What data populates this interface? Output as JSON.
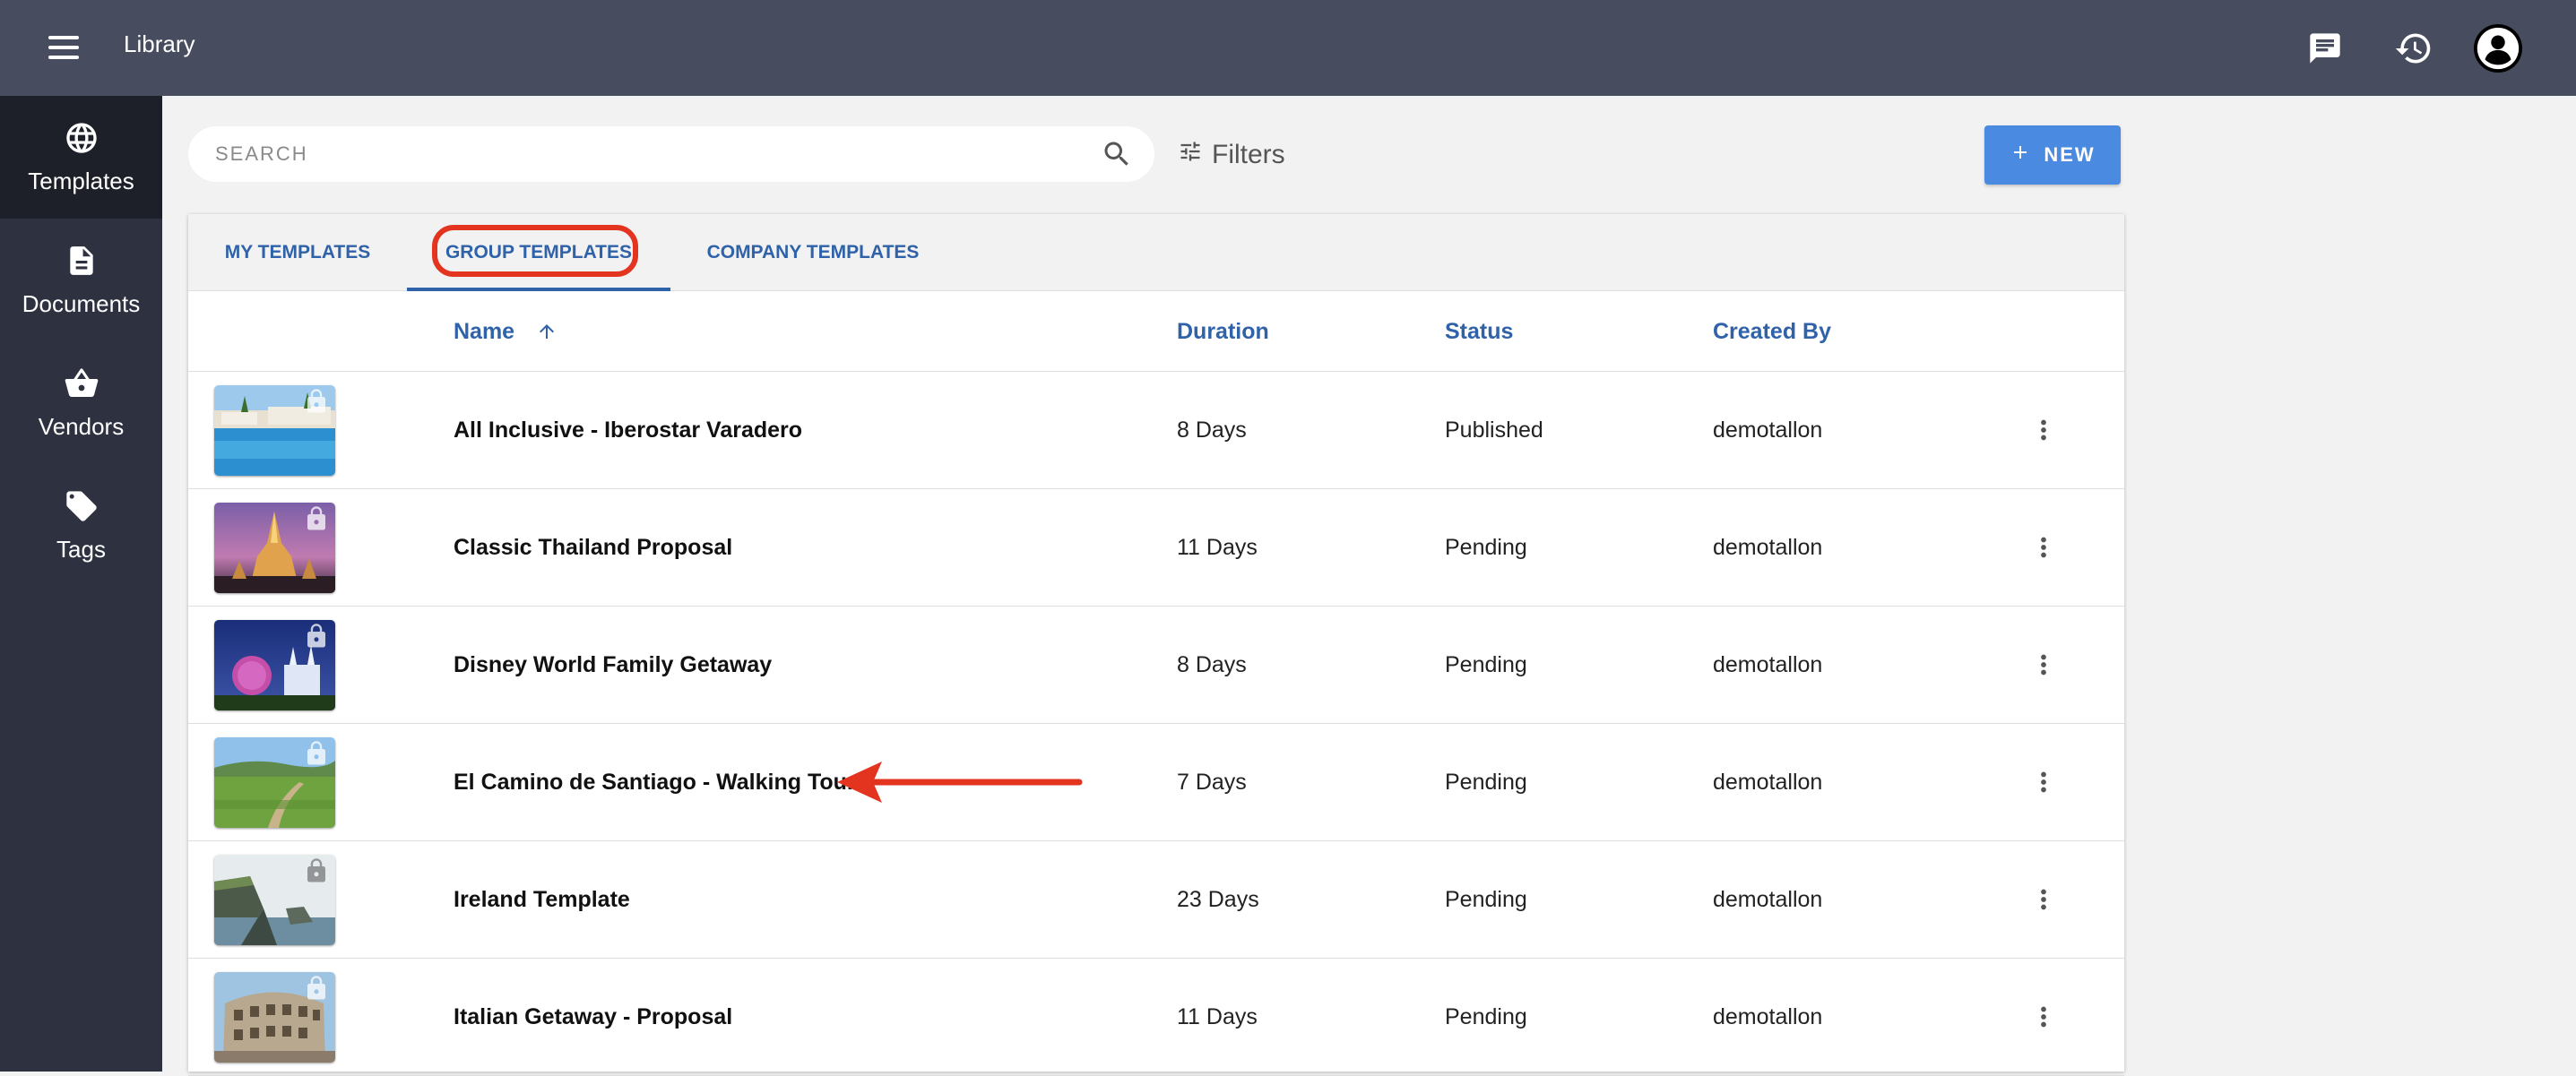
{
  "header": {
    "title": "Library",
    "menu_icon": "hamburger-menu-icon",
    "icons": [
      "chat-icon",
      "history-icon",
      "account-avatar-icon"
    ]
  },
  "sidebar": {
    "items": [
      {
        "label": "Templates",
        "icon": "globe-icon",
        "active": true
      },
      {
        "label": "Documents",
        "icon": "document-icon",
        "active": false
      },
      {
        "label": "Vendors",
        "icon": "basket-icon",
        "active": false
      },
      {
        "label": "Tags",
        "icon": "tag-icon",
        "active": false
      }
    ]
  },
  "search": {
    "placeholder": "SEARCH",
    "value": ""
  },
  "filters": {
    "label": "Filters"
  },
  "new_button": {
    "label": "NEW"
  },
  "tabs": [
    {
      "label": "MY TEMPLATES",
      "active": false
    },
    {
      "label": "GROUP TEMPLATES",
      "active": true
    },
    {
      "label": "COMPANY TEMPLATES",
      "active": false
    }
  ],
  "table": {
    "columns": {
      "name": "Name",
      "duration": "Duration",
      "status": "Status",
      "created_by": "Created By"
    },
    "sort": {
      "column": "name",
      "direction": "ascending"
    },
    "rows": [
      {
        "name": "All Inclusive - Iberostar Varadero",
        "duration": "8 Days",
        "status": "Published",
        "created_by": "demotallon"
      },
      {
        "name": "Classic Thailand Proposal",
        "duration": "11 Days",
        "status": "Pending",
        "created_by": "demotallon"
      },
      {
        "name": "Disney World Family Getaway",
        "duration": "8 Days",
        "status": "Pending",
        "created_by": "demotallon"
      },
      {
        "name": "El Camino de Santiago - Walking Tour",
        "duration": "7 Days",
        "status": "Pending",
        "created_by": "demotallon"
      },
      {
        "name": "Ireland Template",
        "duration": "23 Days",
        "status": "Pending",
        "created_by": "demotallon"
      },
      {
        "name": "Italian Getaway - Proposal",
        "duration": "11 Days",
        "status": "Pending",
        "created_by": "demotallon"
      }
    ]
  },
  "colors": {
    "topbar": "#474d5f",
    "sidebar": "#2d3140",
    "accent": "#2f62a8",
    "new_button": "#4a8ae0",
    "annotation": "#e33420"
  }
}
